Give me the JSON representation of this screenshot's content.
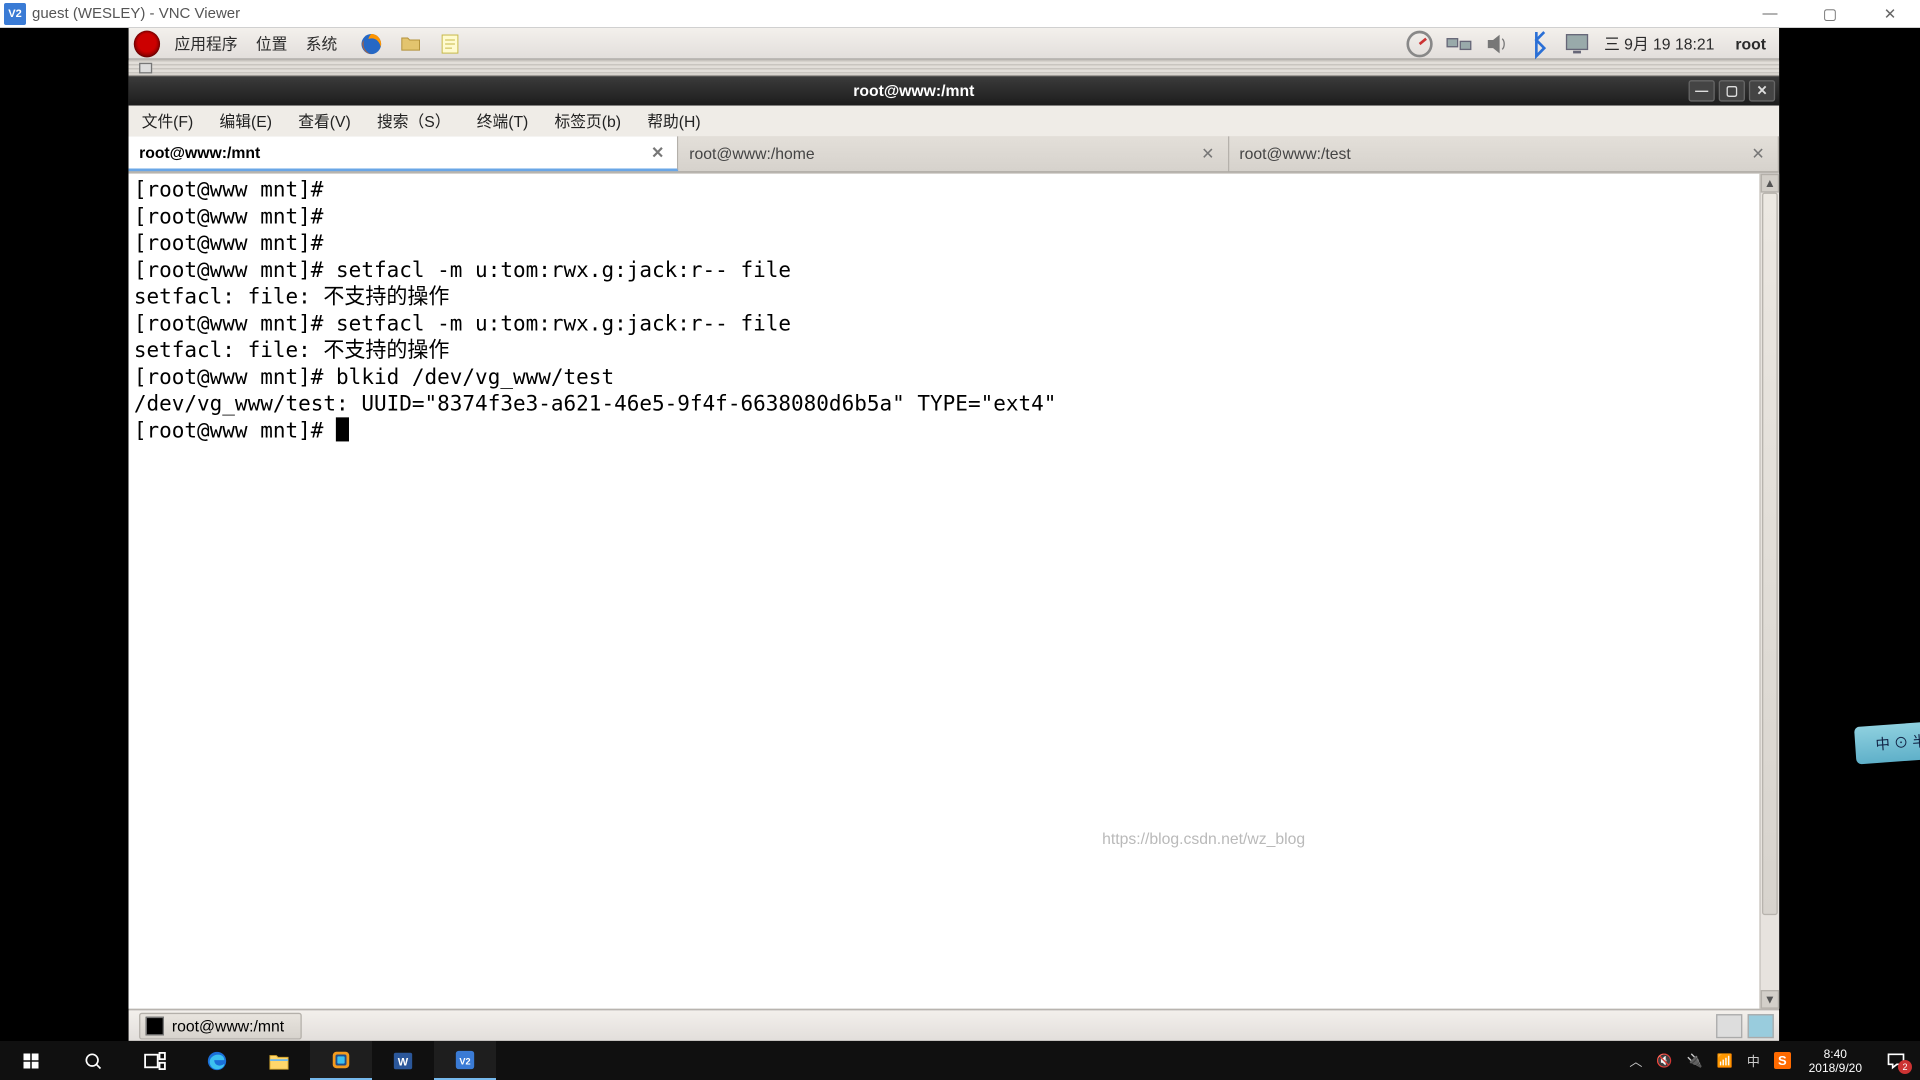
{
  "vnc": {
    "app_icon_text": "V2",
    "title": "guest (WESLEY) - VNC Viewer",
    "btn_min": "—",
    "btn_max": "▢",
    "btn_close": "✕"
  },
  "panel": {
    "apps": "应用程序",
    "places": "位置",
    "system": "系统",
    "clock": "三 9月 19 18:21",
    "user": "root"
  },
  "term": {
    "title": "root@www:/mnt",
    "menu": {
      "file": "文件(F)",
      "edit": "编辑(E)",
      "view": "查看(V)",
      "search": "搜索（S）",
      "terminal": "终端(T)",
      "tabs": "标签页(b)",
      "help": "帮助(H)"
    },
    "tabs": [
      {
        "label": "root@www:/mnt",
        "active": true
      },
      {
        "label": "root@www:/home",
        "active": false
      },
      {
        "label": "root@www:/test",
        "active": false
      }
    ],
    "lines": [
      "[root@www mnt]#",
      "[root@www mnt]#",
      "[root@www mnt]#",
      "[root@www mnt]# setfacl -m u:tom:rwx.g:jack:r-- file",
      "setfacl: file: 不支持的操作",
      "[root@www mnt]# setfacl -m u:tom:rwx.g:jack:r-- file",
      "setfacl: file: 不支持的操作",
      "[root@www mnt]# blkid /dev/vg_www/test",
      "/dev/vg_www/test: UUID=\"8374f3e3-a621-46e5-9f4f-6638080d6b5a\" TYPE=\"ext4\"",
      "[root@www mnt]# "
    ],
    "close_glyph": "✕",
    "min_glyph": "—",
    "max_glyph": "▢"
  },
  "bottom_panel": {
    "task_label": "root@www:/mnt"
  },
  "sticker_text": "中 ⊙ 半",
  "blog_watermark": "https://blog.csdn.net/wz_blog",
  "win_taskbar": {
    "time": "8:40",
    "date": "2018/9/20",
    "notif_count": "2",
    "ime_text": "中"
  }
}
